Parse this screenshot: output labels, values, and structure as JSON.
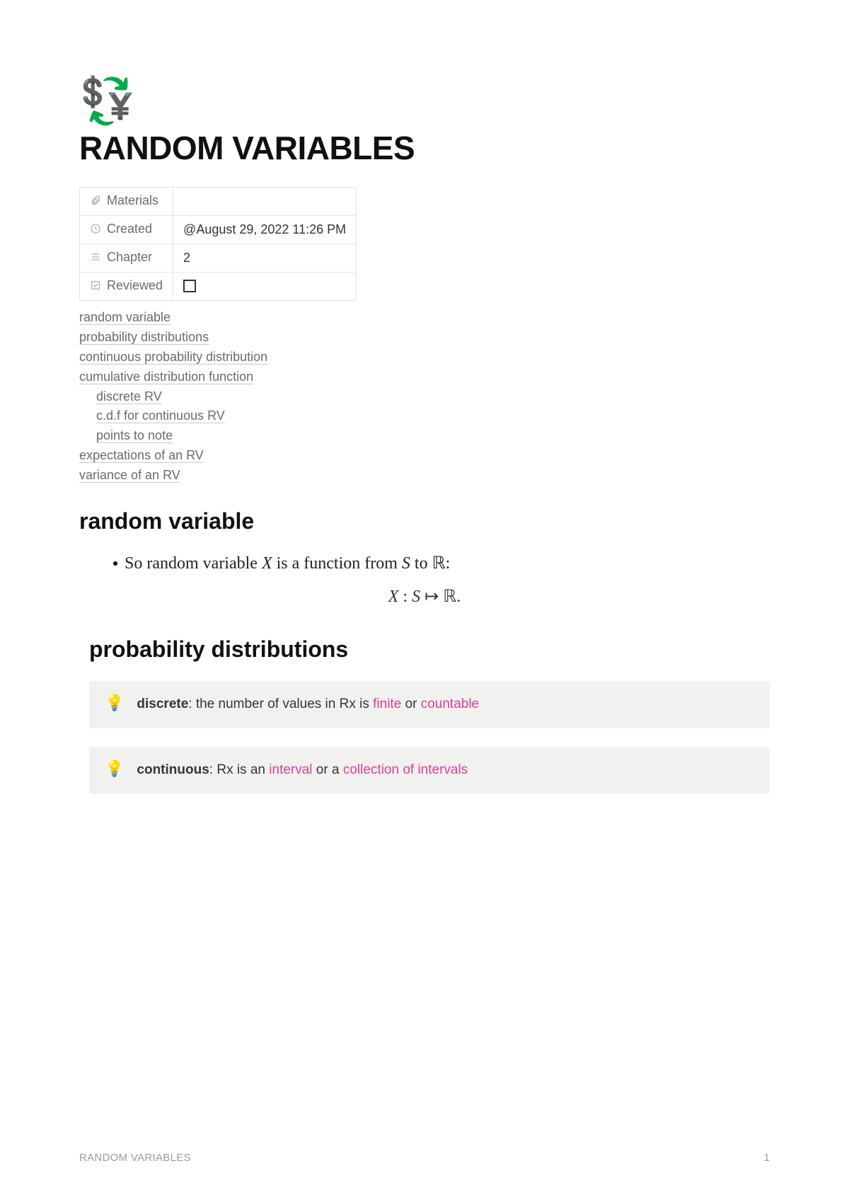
{
  "icon_emoji": "💱",
  "title": "RANDOM VARIABLES",
  "properties": {
    "materials": {
      "label": "Materials",
      "value": ""
    },
    "created": {
      "label": "Created",
      "value": "@August 29, 2022 11:26 PM"
    },
    "chapter": {
      "label": "Chapter",
      "value": "2"
    },
    "reviewed": {
      "label": "Reviewed",
      "checked": false
    }
  },
  "toc": [
    {
      "text": "random variable",
      "indent": 0
    },
    {
      "text": " probability distributions",
      "indent": 0
    },
    {
      "text": "continuous probability distribution",
      "indent": 0
    },
    {
      "text": "cumulative distribution function",
      "indent": 0
    },
    {
      "text": "discrete RV",
      "indent": 1
    },
    {
      "text": "c.d.f for continuous RV",
      "indent": 1
    },
    {
      "text": "points to note",
      "indent": 1
    },
    {
      "text": "expectations of an RV",
      "indent": 0
    },
    {
      "text": "variance of an RV",
      "indent": 0
    }
  ],
  "sections": {
    "rv": {
      "heading": "random variable",
      "bullet_pre": "So random variable ",
      "bullet_mid": " is a function from ",
      "bullet_post": " to ",
      "X": "X",
      "S": "S",
      "R": "ℝ",
      "formula_X": "X",
      "formula_sep": " : ",
      "formula_S": "S",
      "formula_arrow": " ↦ ",
      "formula_R": "ℝ",
      "formula_end": "."
    },
    "pd": {
      "heading": " probability distributions",
      "callout1": {
        "bold": "discrete",
        "pre": ": the number of values in Rx is ",
        "hl1": "finite",
        "mid": " or ",
        "hl2": "countable"
      },
      "callout2": {
        "bold": "continuous",
        "pre": ": Rx is an ",
        "hl1": "interval",
        "mid": " or a ",
        "hl2": "collection of intervals"
      }
    }
  },
  "footer": {
    "title": "RANDOM VARIABLES",
    "page": "1"
  },
  "bulb": "💡"
}
